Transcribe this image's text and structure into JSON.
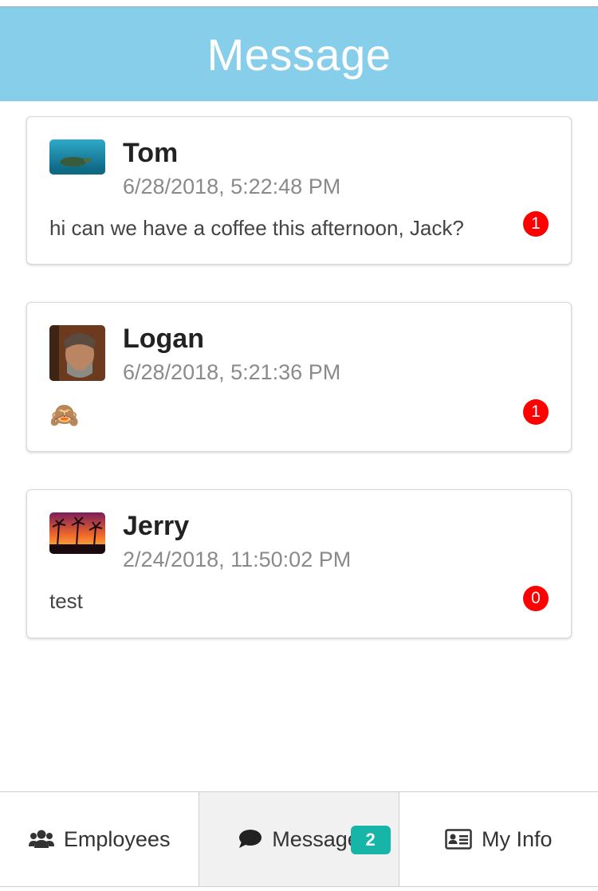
{
  "header": {
    "title": "Message"
  },
  "conversations": [
    {
      "name": "Tom",
      "time": "6/28/2018, 5:22:48 PM",
      "message": "hi can we have a coffee this afternoon, Jack?",
      "unread": "1"
    },
    {
      "name": "Logan",
      "time": "6/28/2018, 5:21:36 PM",
      "message": "🙈",
      "unread": "1"
    },
    {
      "name": "Jerry",
      "time": "2/24/2018, 11:50:02 PM",
      "message": "test",
      "unread": "0"
    }
  ],
  "tabs": {
    "employees": {
      "label": "Employees",
      "icon": "users-icon"
    },
    "message": {
      "label": "Message",
      "icon": "comment-icon",
      "badge": "2"
    },
    "myinfo": {
      "label": "My Info",
      "icon": "id-card-icon"
    }
  },
  "colors": {
    "header": "#87ceeb",
    "unread_badge": "#ff0000",
    "tab_badge": "#16b5a8"
  }
}
